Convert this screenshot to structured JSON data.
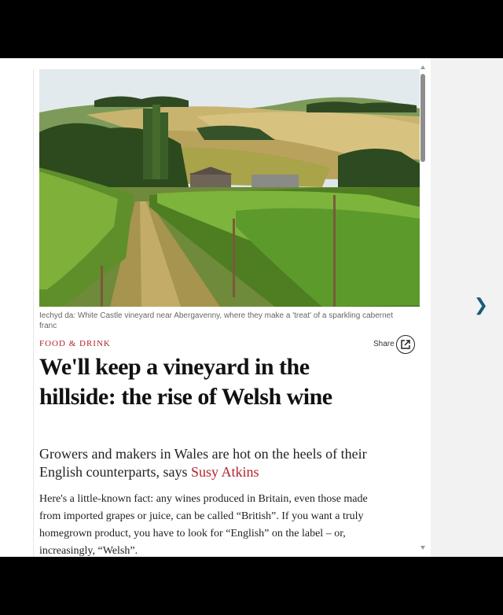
{
  "article": {
    "hero_caption": "Iechyd da: White Castle vineyard near Abergavenny, where they make a 'treat' of a sparkling cabernet franc",
    "section": "FOOD & DRINK",
    "share_label": "Share",
    "headline": "We'll keep a vineyard in the hillside: the rise of Welsh wine",
    "standfirst_text": "Growers and makers in Wales are hot on the heels of their English counterparts, says ",
    "author": "Susy Atkins",
    "body_first_paragraph": "Here's a little-known fact: any wines produced in Britain, even those made from imported grapes or juice, can be called “British”. If you want a truly homegrown product, you have to look for “English” on the label – or, increasingly, “Welsh”."
  },
  "icons": {
    "share": "share-external-icon",
    "next": "chevron-right-icon",
    "scroll_up": "triangle-up-icon",
    "scroll_down": "triangle-down-icon"
  },
  "colors": {
    "accent_red": "#b2232b",
    "link_blue": "#1a5c7a",
    "headline_text": "#111111"
  }
}
